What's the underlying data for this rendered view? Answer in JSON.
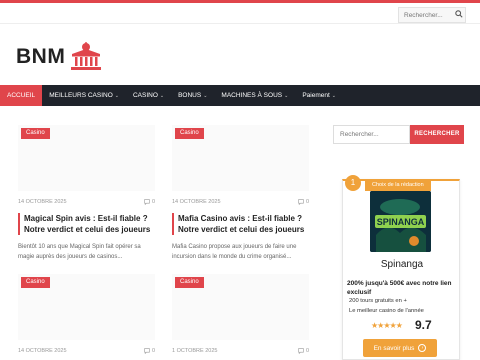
{
  "header": {
    "search_placeholder": "Rechercher...",
    "logo_text": "BNM"
  },
  "nav": {
    "items": [
      {
        "label": "ACCUEIL",
        "chevron": ""
      },
      {
        "label": "MEILLEURS CASINO",
        "chevron": "⌄"
      },
      {
        "label": "CASINO",
        "chevron": "⌄"
      },
      {
        "label": "BONUS",
        "chevron": "⌄"
      },
      {
        "label": "MACHINES À SOUS",
        "chevron": "⌄"
      },
      {
        "label": "Paiement",
        "chevron": "⌄"
      }
    ]
  },
  "posts": [
    {
      "category": "Casino",
      "date": "14 OCTOBRE 2025",
      "comments": "0",
      "title": "Magical Spin avis : Est-il fiable ? Notre verdict et celui des joueurs",
      "excerpt": "Bientôt 10 ans que Magical Spin fait opérer sa magie auprès des joueurs de casinos..."
    },
    {
      "category": "Casino",
      "date": "14 OCTOBRE 2025",
      "comments": "0",
      "title": "Mafia Casino avis : Est-il fiable ? Notre verdict et celui des joueurs",
      "excerpt": "Mafia Casino propose aux joueurs de faire une incursion dans le monde du crime organisé..."
    },
    {
      "category": "Casino",
      "date": "14 OCTOBRE 2025",
      "comments": "0",
      "title": "",
      "excerpt": ""
    },
    {
      "category": "Casino",
      "date": "1 OCTOBRE 2025",
      "comments": "0",
      "title": "",
      "excerpt": ""
    }
  ],
  "sidebar": {
    "search_placeholder": "Rechercher...",
    "search_button": "RECHERCHER"
  },
  "promo": {
    "rank": "1",
    "tag": "Choix de la rédaction",
    "logo_text": "SPINANGA",
    "name": "Spinanga",
    "bonus": "200% jusqu'à 500€ avec notre lien exclusif",
    "features": [
      "200 tours gratuits en +",
      "Le meilleur casino de l'année"
    ],
    "stars": "★★★★★",
    "score": "9.7",
    "cta": "En savoir plus"
  },
  "colors": {
    "accent": "#e0454b",
    "nav_bg": "#1f232b",
    "promo": "#f0a23a"
  }
}
